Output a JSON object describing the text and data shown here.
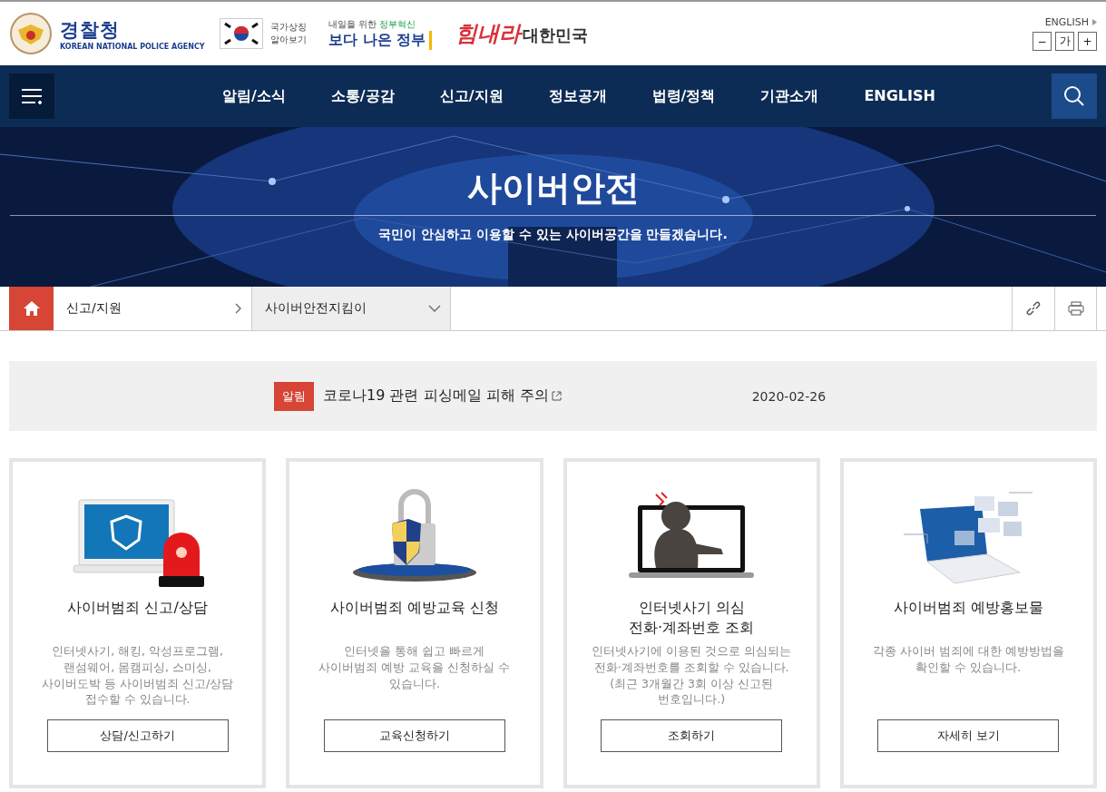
{
  "header": {
    "logo_name": "경찰청",
    "logo_subtitle": "KOREAN NATIONAL POLICE AGENCY",
    "symbol_link": "국가상징\n알아보기",
    "gov_tagline_prefix": "내일을 위한",
    "gov_tagline_accent": "정부혁신",
    "gov_title": "보다 나은 정부",
    "campaign_first": "힘내라",
    "campaign_second": "대한민국",
    "language_link": "ENGLISH",
    "font_buttons": [
      "−",
      "가",
      "+"
    ]
  },
  "nav": {
    "items": [
      "알림/소식",
      "소통/공감",
      "신고/지원",
      "정보공개",
      "법령/정책",
      "기관소개",
      "ENGLISH"
    ]
  },
  "hero": {
    "title": "사이버안전",
    "subtitle": "국민이 안심하고 이용할 수 있는 사이버공간을 만들겠습니다."
  },
  "breadcrumb": {
    "items": [
      {
        "label": "신고/지원",
        "kind": "arrow"
      },
      {
        "label": "사이버안전지킴이",
        "kind": "dropdown"
      }
    ]
  },
  "notice": {
    "badge": "알림",
    "title": "코로나19 관련 피싱메일 피해 주의",
    "date": "2020-02-26"
  },
  "cards": [
    {
      "kind": "report",
      "title": "사이버범죄 신고/상담",
      "description": "인터넷사기, 해킹, 악성프로그램,\n랜섬웨어, 몸캠피싱, 스미싱,\n사이버도박 등 사이버범죄 신고/상담\n접수할 수 있습니다.",
      "button": "상담/신고하기"
    },
    {
      "kind": "education",
      "title": "사이버범죄 예방교육 신청",
      "description": "인터넷을 통해 쉽고 빠르게\n사이버범죄 예방 교육을 신청하실 수\n있습니다.",
      "button": "교육신청하기"
    },
    {
      "kind": "fraud",
      "title": "인터넷사기 의심\n전화·계좌번호 조회",
      "description": "인터넷사기에 이용된 것으로 의심되는\n전화·계좌번호를 조회할 수 있습니다.\n(최근 3개월간 3회 이상 신고된\n번호입니다.)",
      "button": "조회하기"
    },
    {
      "kind": "promo",
      "title": "사이버범죄 예방홍보물",
      "description": "각종 사이버 범죄에 대한 예방방법을\n확인할 수 있습니다.",
      "button": "자세히 보기"
    }
  ]
}
